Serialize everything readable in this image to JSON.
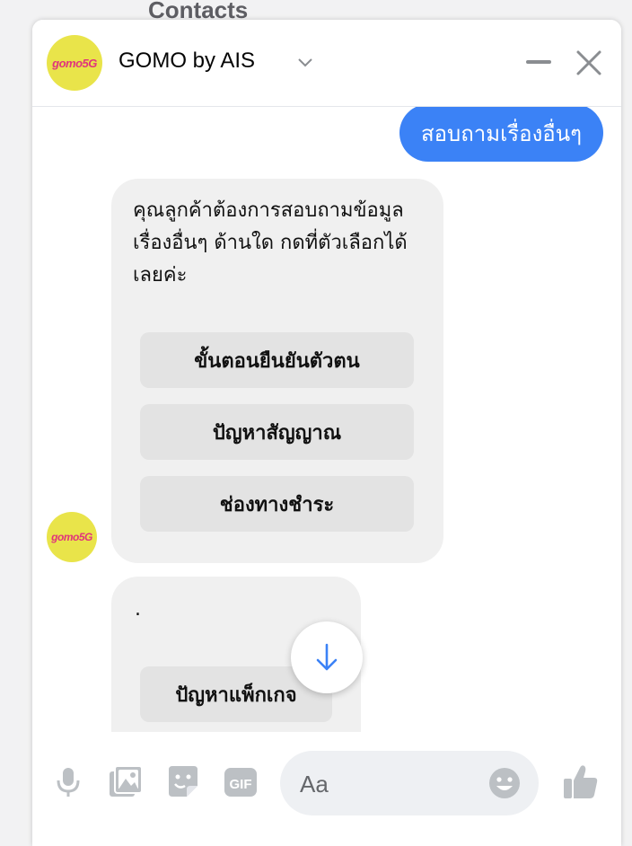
{
  "background": {
    "title": "Contacts"
  },
  "header": {
    "avatar_text": "gomo5G",
    "name": "GOMO by AIS"
  },
  "messages": {
    "sent_text": "สอบถามเรื่องอื่นๆ",
    "bot_text": "คุณลูกค้าต้องการสอบถามข้อมูลเรื่องอื่นๆ ด้านใด กดที่ตัวเลือกได้เลยค่ะ",
    "quick_replies": [
      "ขั้นตอนยืนยันตัวตน",
      "ปัญหาสัญญาณ",
      "ช่องทางชำระ"
    ],
    "second_text": ".",
    "second_reply": "ปัญหาแพ็กเกจ"
  },
  "composer": {
    "placeholder": "Aa",
    "icons": [
      "microphone-icon",
      "image-icon",
      "sticker-icon",
      "gif-icon",
      "emoji-icon",
      "thumbs-up-icon"
    ],
    "gif_label": "GIF"
  },
  "colors": {
    "accent": "#3b82f6",
    "avatar_bg": "#e9e44a",
    "avatar_text": "#e0347c",
    "bubble": "#f0f0f0"
  }
}
